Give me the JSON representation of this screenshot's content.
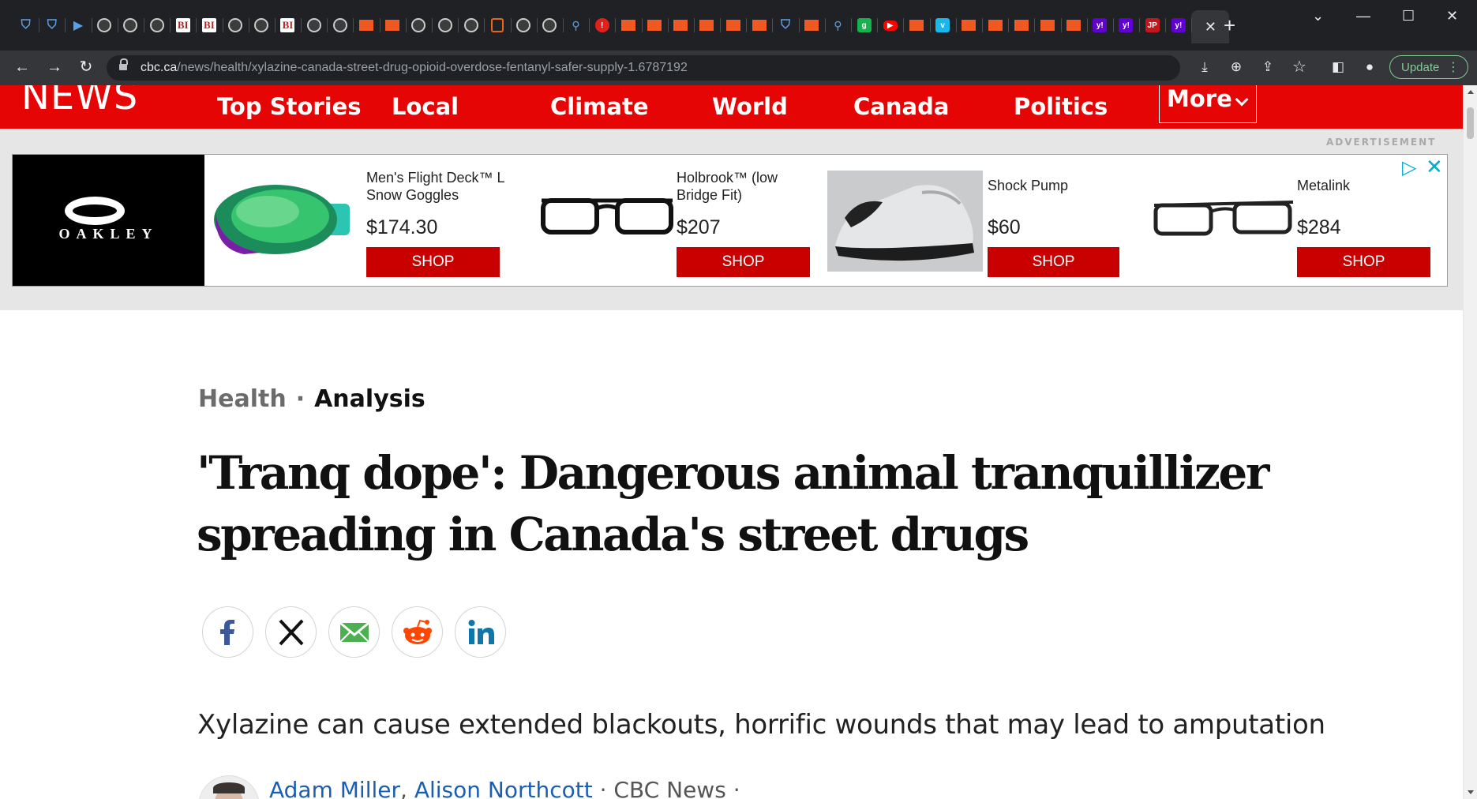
{
  "browser": {
    "tab_favicons": [
      "shield-icon",
      "shield-icon",
      "arrow-icon",
      "globe-icon",
      "globe-icon",
      "globe-icon",
      "bi-icon",
      "bi-icon",
      "globe-icon",
      "globe-icon",
      "bi-icon",
      "globe-icon",
      "globe-icon",
      "ribbon-icon",
      "ribbon-icon",
      "globe-icon",
      "globe-icon",
      "globe-icon",
      "ublock-icon",
      "globe-icon",
      "globe-icon",
      "search-icon",
      "pin-icon",
      "ribbon-icon",
      "ribbon-icon",
      "ribbon-icon",
      "ribbon-icon",
      "ribbon-icon",
      "ribbon-icon",
      "shield-icon",
      "ribbon-icon",
      "search-icon",
      "g-icon",
      "youtube-icon",
      "ribbon-icon",
      "vimeo-icon",
      "ribbon-icon",
      "ribbon-icon",
      "ribbon-icon",
      "ribbon-icon",
      "ribbon-icon",
      "yahoo-icon",
      "yahoo-icon",
      "jp-icon",
      "yahoo-icon"
    ],
    "address": {
      "domain": "cbc.ca",
      "path": "/news/health/xylazine-canada-street-drug-opioid-overdose-fentanyl-safer-supply-1.6787192"
    },
    "update_label": "Update"
  },
  "site": {
    "brand": "NEWS",
    "nav": [
      "Top Stories",
      "Local",
      "Climate",
      "World",
      "Canada",
      "Politics"
    ],
    "more_label": "More",
    "accent_color": "#e60505"
  },
  "ad": {
    "label": "ADVERTISEMENT",
    "brand": "OAKLEY",
    "products": [
      {
        "name": "Men's Flight Deck™ L Snow Goggles",
        "price": "$174.30",
        "cta": "SHOP"
      },
      {
        "name": "Holbrook™ (low Bridge Fit)",
        "price": "$207",
        "cta": "SHOP"
      },
      {
        "name": "Shock Pump",
        "price": "$60",
        "cta": "SHOP"
      },
      {
        "name": "Metalink",
        "price": "$284",
        "cta": "SHOP"
      }
    ]
  },
  "article": {
    "section": "Health",
    "kicker": "Analysis",
    "headline": "'Tranq dope': Dangerous animal tranquillizer spreading in Canada's street drugs",
    "share": [
      "facebook-icon",
      "x-icon",
      "email-icon",
      "reddit-icon",
      "linkedin-icon"
    ],
    "deck": "Xylazine can cause extended blackouts, horrific wounds that may lead to amputation",
    "authors": [
      "Adam Miller",
      "Alison Northcott"
    ],
    "source": "CBC News"
  }
}
